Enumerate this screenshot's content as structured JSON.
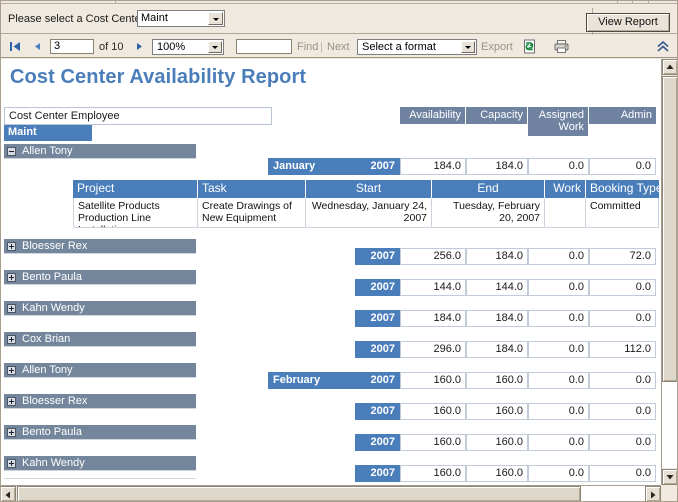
{
  "parameter_bar": {
    "label": "Please select a Cost Center",
    "selected_value": "Maint",
    "view_report_label": "View Report"
  },
  "nav_toolbar": {
    "first_page_icon": "first-page-icon",
    "prev_page_icon": "previous-page-icon",
    "next_page_icon": "next-page-icon",
    "last_page_icon": "last-page-icon",
    "current_page": "3",
    "page_of_text": "of 10",
    "zoom_level": "100%",
    "find_value": "",
    "find_label": "Find",
    "find_separator": "|",
    "next_label": "Next",
    "format_placeholder": "Select a format",
    "export_label": "Export",
    "refresh_icon": "refresh-icon",
    "print_icon": "print-icon",
    "collapse_icon": "chevron-up-icon"
  },
  "report": {
    "title": "Cost Center Availability Report",
    "cost_center_employee_label": "Cost Center Employee",
    "cost_center_name": "Maint",
    "columns": [
      {
        "label": "Availability"
      },
      {
        "label": "Capacity"
      },
      {
        "label": "Assigned Work"
      },
      {
        "label": "Admin"
      }
    ],
    "detail_headers": [
      "Project",
      "Task",
      "Start",
      "End",
      "Work",
      "Booking Type"
    ],
    "detail_rows": [
      {
        "project": "Satellite Products Production Line Installation",
        "task": "Create Drawings of New Equipment",
        "start": "Wednesday, January 24, 2007",
        "end": "Tuesday, February 20, 2007",
        "work": "",
        "booking_type": "Committed"
      }
    ],
    "rows": [
      {
        "employee": "Allen Tony",
        "expanded": true,
        "month": "January",
        "year": "2007",
        "availability": "184.0",
        "capacity": "184.0",
        "assigned_work": "0.0",
        "admin": "0.0"
      },
      {
        "employee": "Bloesser Rex",
        "expanded": false,
        "month": "",
        "year": "2007",
        "availability": "256.0",
        "capacity": "184.0",
        "assigned_work": "0.0",
        "admin": "72.0"
      },
      {
        "employee": "Bento Paula",
        "expanded": false,
        "month": "",
        "year": "2007",
        "availability": "144.0",
        "capacity": "144.0",
        "assigned_work": "0.0",
        "admin": "0.0"
      },
      {
        "employee": "Kahn Wendy",
        "expanded": false,
        "month": "",
        "year": "2007",
        "availability": "184.0",
        "capacity": "184.0",
        "assigned_work": "0.0",
        "admin": "0.0"
      },
      {
        "employee": "Cox Brian",
        "expanded": false,
        "month": "",
        "year": "2007",
        "availability": "296.0",
        "capacity": "184.0",
        "assigned_work": "0.0",
        "admin": "112.0"
      },
      {
        "employee": "Allen Tony",
        "expanded": false,
        "month": "February",
        "year": "2007",
        "availability": "160.0",
        "capacity": "160.0",
        "assigned_work": "0.0",
        "admin": "0.0"
      },
      {
        "employee": "Bloesser Rex",
        "expanded": false,
        "month": "",
        "year": "2007",
        "availability": "160.0",
        "capacity": "160.0",
        "assigned_work": "0.0",
        "admin": "0.0"
      },
      {
        "employee": "Bento Paula",
        "expanded": false,
        "month": "",
        "year": "2007",
        "availability": "160.0",
        "capacity": "160.0",
        "assigned_work": "0.0",
        "admin": "0.0"
      },
      {
        "employee": "Kahn Wendy",
        "expanded": false,
        "month": "",
        "year": "2007",
        "availability": "160.0",
        "capacity": "160.0",
        "assigned_work": "0.0",
        "admin": "0.0"
      }
    ]
  },
  "colors": {
    "accent_blue": "#4a7ebb",
    "header_slate": "#6f82a0",
    "employee_bar": "#74869b",
    "chrome": "#efe9df"
  }
}
